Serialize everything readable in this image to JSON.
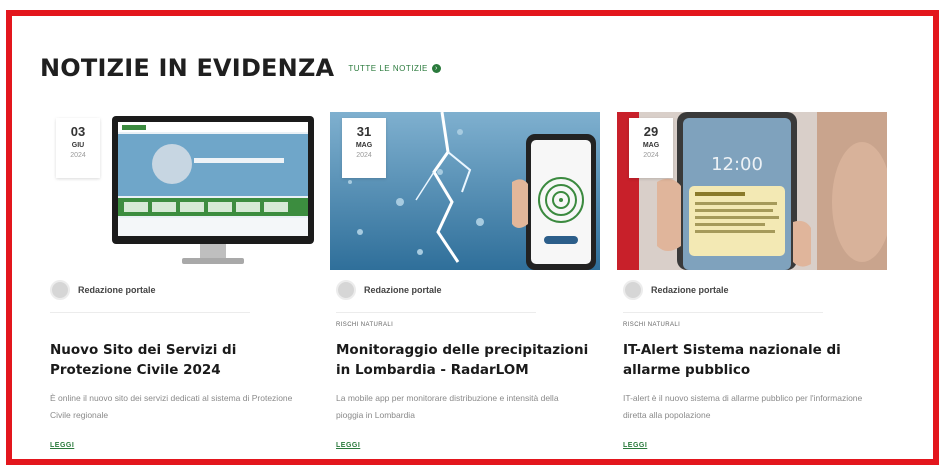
{
  "section": {
    "title": "NOTIZIE IN EVIDENZA",
    "all_news_label": "TUTTE LE NOTIZIE",
    "all_news_icon": "arrow-right-circle-icon"
  },
  "colors": {
    "frame": "#e3161d",
    "accent": "#2a7a3c"
  },
  "cards": [
    {
      "date": {
        "day": "03",
        "month": "GIU",
        "year": "2024"
      },
      "image_icon": "computer-monitor-website-image",
      "author": "Redazione portale",
      "category": "",
      "title": "Nuovo Sito dei Servizi di Protezione Civile 2024",
      "description": "È online il nuovo sito dei servizi dedicati al sistema di Protezione Civile regionale",
      "read_more": "LEGGI"
    },
    {
      "date": {
        "day": "31",
        "month": "MAG",
        "year": "2024"
      },
      "image_icon": "lightning-radar-phone-image",
      "author": "Redazione portale",
      "category": "RISCHI NATURALI",
      "title": "Monitoraggio delle precipitazioni in Lombardia - RadarLOM",
      "description": "La mobile app per monitorare distribuzione e intensità della pioggia in Lombardia",
      "read_more": "LEGGI"
    },
    {
      "date": {
        "day": "29",
        "month": "MAG",
        "year": "2024"
      },
      "image_icon": "phone-alert-image",
      "author": "Redazione portale",
      "category": "RISCHI NATURALI",
      "title": "IT-Alert Sistema nazionale di allarme pubblico",
      "description": "IT-alert è il nuovo sistema di allarme pubblico per l'informazione diretta alla popolazione",
      "read_more": "LEGGI"
    }
  ]
}
